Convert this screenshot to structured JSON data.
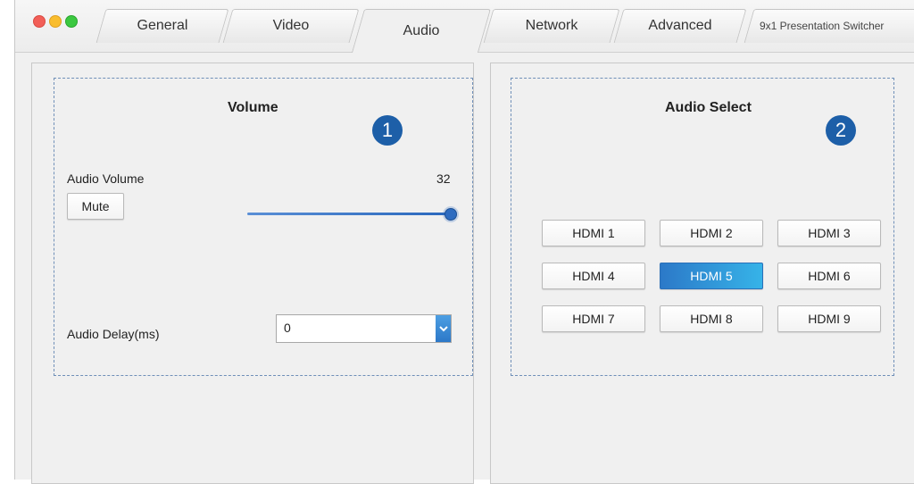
{
  "window": {
    "tabs": [
      {
        "label": "General"
      },
      {
        "label": "Video"
      },
      {
        "label": "Audio"
      },
      {
        "label": "Network"
      },
      {
        "label": "Advanced"
      }
    ],
    "active_tab": "Audio",
    "app_title": "9x1 Presentation Switcher"
  },
  "volume_group": {
    "title": "Volume",
    "badge": "1",
    "audio_volume_label": "Audio Volume",
    "audio_volume_value": "32",
    "slider_fraction": 1.0,
    "mute_label": "Mute",
    "audio_delay_label": "Audio Delay(ms)",
    "audio_delay_value": "0"
  },
  "audio_select_group": {
    "title": "Audio Select",
    "badge": "2",
    "buttons": [
      {
        "label": "HDMI 1"
      },
      {
        "label": "HDMI 2"
      },
      {
        "label": "HDMI 3"
      },
      {
        "label": "HDMI 4"
      },
      {
        "label": "HDMI 5"
      },
      {
        "label": "HDMI 6"
      },
      {
        "label": "HDMI 7"
      },
      {
        "label": "HDMI 8"
      },
      {
        "label": "HDMI 9"
      }
    ],
    "selected": "HDMI 5"
  },
  "colors": {
    "accent": "#2c79c8",
    "badge": "#1d5fa8",
    "group_border": "#6f8fb8"
  },
  "icons": {
    "close": "close-icon",
    "minimize": "minimize-icon",
    "zoom": "zoom-icon",
    "dropdown": "chevron-down-icon"
  }
}
